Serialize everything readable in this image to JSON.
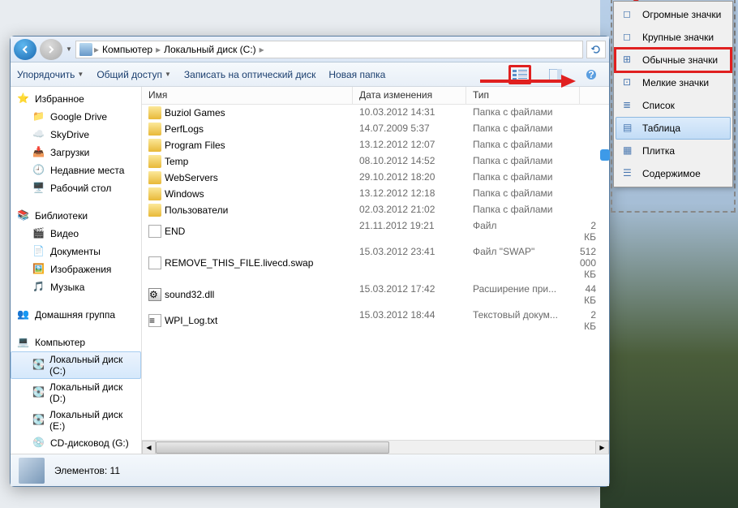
{
  "breadcrumb": {
    "root": "Компьютер",
    "drive": "Локальный диск (C:)"
  },
  "toolbar": {
    "organize": "Упорядочить",
    "share": "Общий доступ",
    "burn": "Записать на оптический диск",
    "newfolder": "Новая папка"
  },
  "sidebar": {
    "favorites": {
      "header": "Избранное",
      "items": [
        "Google Drive",
        "SkyDrive",
        "Загрузки",
        "Недавние места",
        "Рабочий стол"
      ]
    },
    "libraries": {
      "header": "Библиотеки",
      "items": [
        "Видео",
        "Документы",
        "Изображения",
        "Музыка"
      ]
    },
    "homegroup": {
      "header": "Домашняя группа"
    },
    "computer": {
      "header": "Компьютер",
      "items": [
        "Локальный диск (C:)",
        "Локальный диск (D:)",
        "Локальный диск (E:)",
        "CD-дисковод (G:)"
      ]
    }
  },
  "columns": {
    "name": "Имя",
    "date": "Дата изменения",
    "type": "Тип"
  },
  "files": [
    {
      "name": "Buziol Games",
      "date": "10.03.2012 14:31",
      "type": "Папка с файлами",
      "size": "",
      "kind": "folder"
    },
    {
      "name": "PerfLogs",
      "date": "14.07.2009 5:37",
      "type": "Папка с файлами",
      "size": "",
      "kind": "folder"
    },
    {
      "name": "Program Files",
      "date": "13.12.2012 12:07",
      "type": "Папка с файлами",
      "size": "",
      "kind": "folder"
    },
    {
      "name": "Temp",
      "date": "08.10.2012 14:52",
      "type": "Папка с файлами",
      "size": "",
      "kind": "folder"
    },
    {
      "name": "WebServers",
      "date": "29.10.2012 18:20",
      "type": "Папка с файлами",
      "size": "",
      "kind": "folder"
    },
    {
      "name": "Windows",
      "date": "13.12.2012 12:18",
      "type": "Папка с файлами",
      "size": "",
      "kind": "folder"
    },
    {
      "name": "Пользователи",
      "date": "02.03.2012 21:02",
      "type": "Папка с файлами",
      "size": "",
      "kind": "folder"
    },
    {
      "name": "END",
      "date": "21.11.2012 19:21",
      "type": "Файл",
      "size": "2 КБ",
      "kind": "file"
    },
    {
      "name": "REMOVE_THIS_FILE.livecd.swap",
      "date": "15.03.2012 23:41",
      "type": "Файл \"SWAP\"",
      "size": "512 000 КБ",
      "kind": "file"
    },
    {
      "name": "sound32.dll",
      "date": "15.03.2012 17:42",
      "type": "Расширение при...",
      "size": "44 КБ",
      "kind": "dll"
    },
    {
      "name": "WPI_Log.txt",
      "date": "15.03.2012 18:44",
      "type": "Текстовый докум...",
      "size": "2 КБ",
      "kind": "txt"
    }
  ],
  "status": {
    "label": "Элементов: 11"
  },
  "view_menu": [
    "Огромные значки",
    "Крупные значки",
    "Обычные значки",
    "Мелкие значки",
    "Список",
    "Таблица",
    "Плитка",
    "Содержимое"
  ]
}
